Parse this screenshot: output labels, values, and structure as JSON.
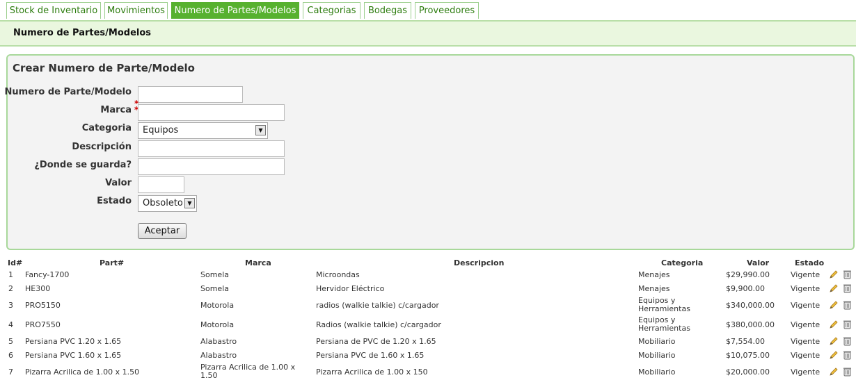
{
  "tabs": [
    {
      "label": "Stock de Inventario"
    },
    {
      "label": "Movimientos"
    },
    {
      "label": "Numero de Partes/Modelos"
    },
    {
      "label": "Categorias"
    },
    {
      "label": "Bodegas"
    },
    {
      "label": "Proveedores"
    }
  ],
  "header": {
    "title": "Numero de Partes/Modelos"
  },
  "form": {
    "title": "Crear Numero de Parte/Modelo",
    "labels": {
      "part": "Numero de Parte/Modelo",
      "marca": "Marca",
      "categoria": "Categoria",
      "descripcion": "Descripción",
      "donde": "¿Donde se guarda?",
      "valor": "Valor",
      "estado": "Estado"
    },
    "required_mark": "*",
    "categoria_value": "Equipos",
    "estado_value": "Obsoleto",
    "submit_label": "Aceptar"
  },
  "table": {
    "headers": {
      "id": "Id#",
      "part": "Part#",
      "marca": "Marca",
      "descripcion": "Descripcion",
      "categoria": "Categoria",
      "valor": "Valor",
      "estado": "Estado"
    },
    "rows": [
      {
        "id": "1",
        "part": "Fancy-1700",
        "marca": "Somela",
        "descripcion": "Microondas",
        "categoria": "Menajes",
        "valor": "$29,990.00",
        "estado": "Vigente"
      },
      {
        "id": "2",
        "part": "HE300",
        "marca": "Somela",
        "descripcion": "Hervidor Eléctrico",
        "categoria": "Menajes",
        "valor": "$9,900.00",
        "estado": "Vigente"
      },
      {
        "id": "3",
        "part": "PRO5150",
        "marca": "Motorola",
        "descripcion": "radios (walkie talkie) c/cargador",
        "categoria": "Equipos y Herramientas",
        "valor": "$340,000.00",
        "estado": "Vigente"
      },
      {
        "id": "4",
        "part": "PRO7550",
        "marca": "Motorola",
        "descripcion": "Radios (walkie talkie) c/cargador",
        "categoria": "Equipos y Herramientas",
        "valor": "$380,000.00",
        "estado": "Vigente"
      },
      {
        "id": "5",
        "part": "Persiana PVC 1.20 x 1.65",
        "marca": "Alabastro",
        "descripcion": "Persiana de PVC de 1.20 x 1.65",
        "categoria": "Mobiliario",
        "valor": "$7,554.00",
        "estado": "Vigente"
      },
      {
        "id": "6",
        "part": "Persiana PVC 1.60 x 1.65",
        "marca": "Alabastro",
        "descripcion": "Persiana PVC de 1.60 x 1.65",
        "categoria": "Mobiliario",
        "valor": "$10,075.00",
        "estado": "Vigente"
      },
      {
        "id": "7",
        "part": "Pizarra Acrilica de 1.00 x 1.50",
        "marca": "Pizarra Acrilica de 1.00 x 1.50",
        "descripcion": "Pizarra Acrilica de 1.00 x 150",
        "categoria": "Mobiliario",
        "valor": "$20,000.00",
        "estado": "Vigente"
      }
    ]
  },
  "colors": {
    "accent": "#57b12f",
    "header_bg": "#eaf7df",
    "border": "#a8d89a",
    "required": "#cc0000"
  },
  "icons": {
    "edit": "pencil-icon",
    "delete": "trash-icon"
  }
}
